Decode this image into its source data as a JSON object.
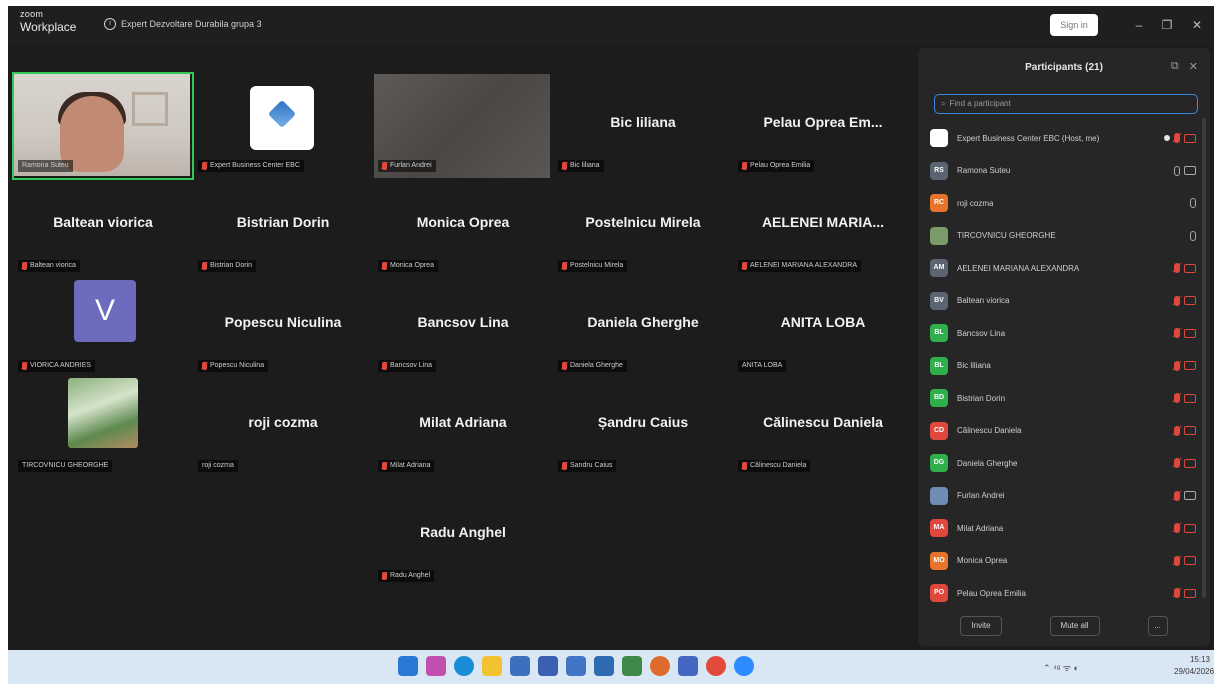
{
  "app": {
    "logo_small": "zoom",
    "logo_big": "Workplace",
    "meeting_title": "Expert Dezvoltare Durabila grupa 3",
    "sign_in": "Sign in"
  },
  "window_controls": {
    "minimize": "–",
    "restore": "❐",
    "close": "✕"
  },
  "tiles": [
    {
      "type": "video-woman",
      "label": "Ramona Suteu",
      "muted": false,
      "active": true
    },
    {
      "type": "logo",
      "label": "Expert Business Center EBC",
      "muted": true
    },
    {
      "type": "blurred",
      "label": "Furlan Andrei",
      "muted": true
    },
    {
      "type": "name",
      "name": "Bic liliana",
      "label": "Bic liliana",
      "muted": true
    },
    {
      "type": "name",
      "name": "Pelau Oprea Em...",
      "label": "Pelau Oprea Emilia",
      "muted": true
    },
    {
      "type": "name",
      "name": "Baltean viorica",
      "label": "Baltean viorica",
      "muted": true
    },
    {
      "type": "name",
      "name": "Bistrian Dorin",
      "label": "Bistrian Dorin",
      "muted": true
    },
    {
      "type": "name",
      "name": "Monica Oprea",
      "label": "Monica Oprea",
      "muted": true
    },
    {
      "type": "name",
      "name": "Postelnicu Mirela",
      "label": "Postelnicu Mirela",
      "muted": true
    },
    {
      "type": "name",
      "name": "AELENEI MARIA...",
      "label": "AELENEI MARIANA ALEXANDRA",
      "muted": true
    },
    {
      "type": "avatar",
      "initial": "V",
      "label": "VIORICA ANDRIES",
      "muted": true
    },
    {
      "type": "name",
      "name": "Popescu Niculina",
      "label": "Popescu Niculina",
      "muted": true
    },
    {
      "type": "name",
      "name": "Bancsov Lina",
      "label": "Bancsov Lina",
      "muted": true
    },
    {
      "type": "name",
      "name": "Daniela Gherghe",
      "label": "Daniela Gherghe",
      "muted": true
    },
    {
      "type": "name",
      "name": "ANITA LOBA",
      "label": "ANITA LOBA",
      "muted": false
    },
    {
      "type": "garden",
      "label": "TIRCOVNICU GHEORGHE",
      "muted": false
    },
    {
      "type": "name",
      "name": "roji cozma",
      "label": "roji cozma",
      "muted": false
    },
    {
      "type": "name",
      "name": "Milat Adriana",
      "label": "Milat Adriana",
      "muted": true
    },
    {
      "type": "name",
      "name": "Șandru Caius",
      "label": "Sandru Caius",
      "muted": true
    },
    {
      "type": "name",
      "name": "Călinescu Daniela",
      "label": "Călinescu Daniela",
      "muted": true
    },
    {
      "type": "name",
      "name": "Radu Anghel",
      "label": "Radu Anghel",
      "muted": true
    }
  ],
  "participants": {
    "title": "Participants (21)",
    "search_placeholder": "Find a participant",
    "invite": "Invite",
    "mute_all": "Mute all",
    "more": "...",
    "list": [
      {
        "initials": "",
        "color": "#ffffff",
        "name": "Expert Business Center EBC (Host, me)",
        "state": "host"
      },
      {
        "initials": "RS",
        "color": "#5a6472",
        "name": "Ramona Suteu",
        "state": "on"
      },
      {
        "initials": "RC",
        "color": "#e8742c",
        "name": "roji cozma",
        "state": "mic"
      },
      {
        "initials": "",
        "color": "#7c9a6a",
        "name": "TIRCOVNICU GHEORGHE",
        "state": "mic"
      },
      {
        "initials": "AM",
        "color": "#5a6472",
        "name": "AELENEI MARIANA ALEXANDRA",
        "state": "off"
      },
      {
        "initials": "BV",
        "color": "#5a6472",
        "name": "Baltean viorica",
        "state": "off"
      },
      {
        "initials": "BL",
        "color": "#2fb04a",
        "name": "Bancsov Lina",
        "state": "off"
      },
      {
        "initials": "BL",
        "color": "#2fb04a",
        "name": "Bic liliana",
        "state": "off"
      },
      {
        "initials": "BD",
        "color": "#2fb04a",
        "name": "Bistrian Dorin",
        "state": "off"
      },
      {
        "initials": "CD",
        "color": "#e0483e",
        "name": "Călinescu Daniela",
        "state": "off"
      },
      {
        "initials": "DG",
        "color": "#2fb04a",
        "name": "Daniela Gherghe",
        "state": "off"
      },
      {
        "initials": "",
        "color": "#6f8cb5",
        "name": "Furlan Andrei",
        "state": "offmic"
      },
      {
        "initials": "MA",
        "color": "#e0483e",
        "name": "Milat Adriana",
        "state": "off"
      },
      {
        "initials": "MO",
        "color": "#e8742c",
        "name": "Monica Oprea",
        "state": "off"
      },
      {
        "initials": "PO",
        "color": "#e0483e",
        "name": "Pelau Oprea Emilia",
        "state": "off"
      }
    ]
  },
  "taskbar": {
    "icons": [
      "windows-icon",
      "copilot-icon",
      "edge-icon",
      "explorer-icon",
      "store-icon",
      "teams-icon",
      "app-icon-1",
      "app-icon-2",
      "app-icon-3",
      "chrome-icon",
      "app-icon-4",
      "chrome-canary-icon",
      "zoom-icon"
    ],
    "icon_colors": [
      "#2b78d6",
      "#c14fb0",
      "#1b8dd7",
      "#f2c230",
      "#3e6fbf",
      "#3b5fb3",
      "#4375c6",
      "#2e6ab1",
      "#3f8a4a",
      "#de6b2b",
      "#4468c2",
      "#e24a3c",
      "#2d8cff"
    ],
    "tray": "⌃  ⁴ᵍ  ᯤ  ◐",
    "time": "15:13",
    "date": "29/04/2026"
  }
}
